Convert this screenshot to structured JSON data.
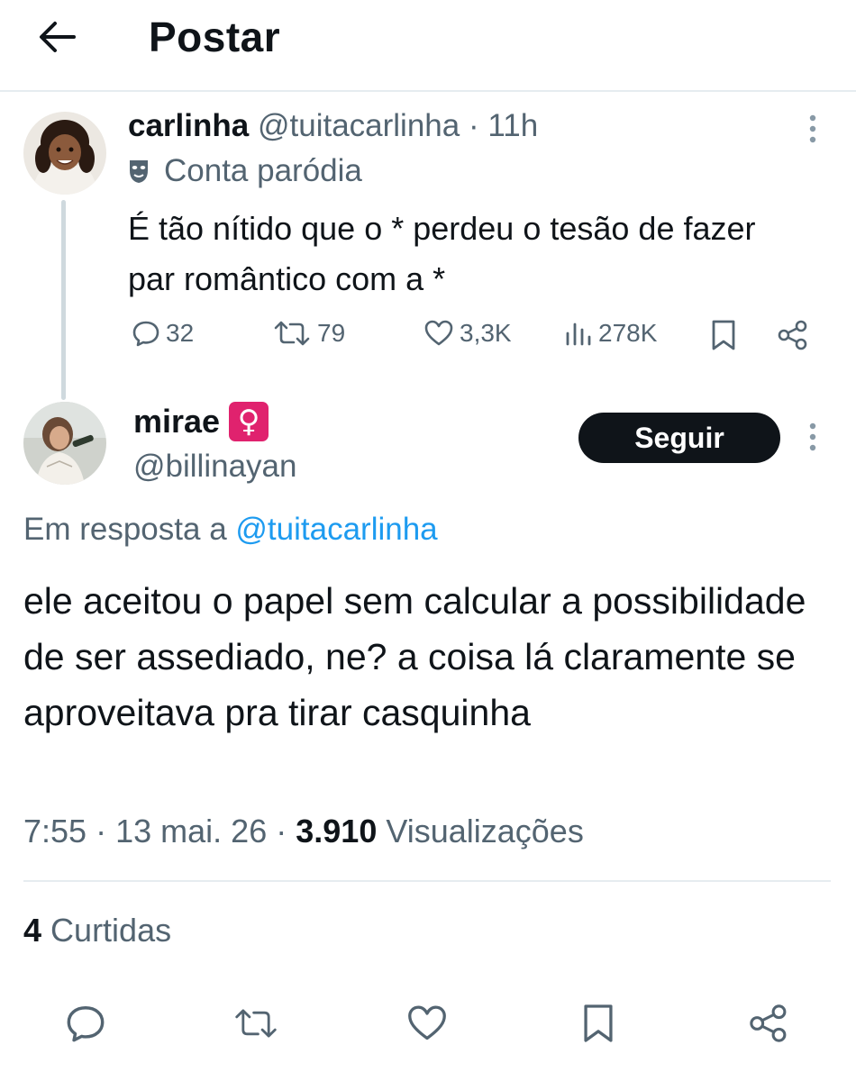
{
  "header": {
    "title": "Postar"
  },
  "parent_post": {
    "name": "carlinha",
    "handle": "@tuitacarlinha",
    "separator": "·",
    "time": "11h",
    "parody_label": "Conta paródia",
    "text": "É tão nítido que o * perdeu o tesão de fazer par romântico com a *",
    "stats": {
      "replies": "32",
      "reposts": "79",
      "likes": "3,3K",
      "views": "278K"
    }
  },
  "reply_post": {
    "name": "mirae",
    "emoji": "♀",
    "handle": "@billinayan",
    "follow_label": "Seguir",
    "reply_prefix": "Em resposta a",
    "reply_handle": "@tuitacarlinha",
    "text": "ele aceitou o papel sem calcular a possibilidade de ser assediado, ne? a coisa lá claramente se aproveitava pra tirar casquinha",
    "time": "7:55",
    "date": "13 mai. 26",
    "separator": "·",
    "views_count": "3.910",
    "views_label": "Visualizações",
    "likes_count": "4",
    "likes_label": "Curtidas"
  },
  "colors": {
    "text_primary": "#0f1419",
    "text_secondary": "#536471",
    "link": "#1d9bf0",
    "divider": "#e6ecf0",
    "thread_line": "#cfd9de",
    "button_dark": "#0f1419",
    "venus_badge": "#e0226e"
  },
  "icons": {
    "back": "arrow-left-icon",
    "more": "more-vertical-icon",
    "parody": "mask-icon",
    "reply": "comment-icon",
    "repost": "repost-icon",
    "like": "heart-icon",
    "views": "bar-chart-icon",
    "bookmark": "bookmark-icon",
    "share": "share-icon"
  }
}
